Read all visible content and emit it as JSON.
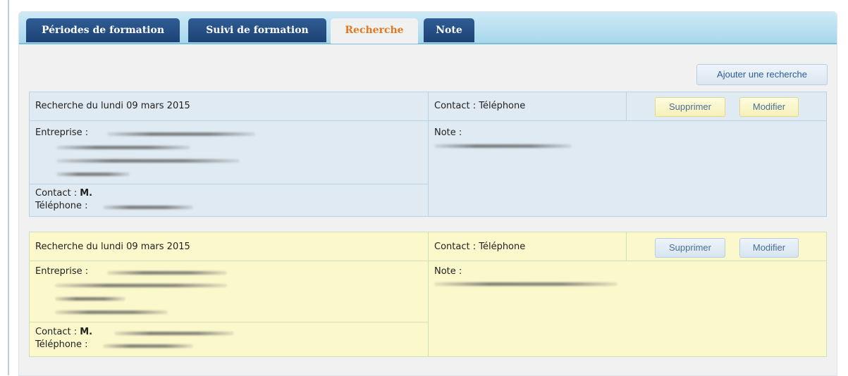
{
  "tabs": [
    {
      "label": "Périodes de formation"
    },
    {
      "label": "Suivi de formation"
    },
    {
      "label": "Recherche",
      "active": true
    },
    {
      "label": "Note"
    }
  ],
  "toolbar": {
    "add_label": "Ajouter une recherche"
  },
  "records": [
    {
      "title": "Recherche du lundi 09 mars 2015",
      "contact_mode": "Contact : Téléphone",
      "delete_label": "Supprimer",
      "edit_label": "Modifier",
      "company_label": "Entreprise :",
      "note_label": "Note :",
      "contact_label": "Contact :",
      "contact_name": "M.",
      "phone_label": "Téléphone :"
    },
    {
      "title": "Recherche du lundi 09 mars 2015",
      "contact_mode": "Contact : Téléphone",
      "delete_label": "Supprimer",
      "edit_label": "Modifier",
      "company_label": "Entreprise :",
      "note_label": "Note :",
      "contact_label": "Contact :",
      "contact_name": "M.",
      "phone_label": "Téléphone :"
    }
  ],
  "colors": {
    "tab_bg": "#1d4275",
    "tab_active_text": "#e07a22",
    "card_blue": "#dfeaf2",
    "card_yellow": "#fbf8cc"
  }
}
